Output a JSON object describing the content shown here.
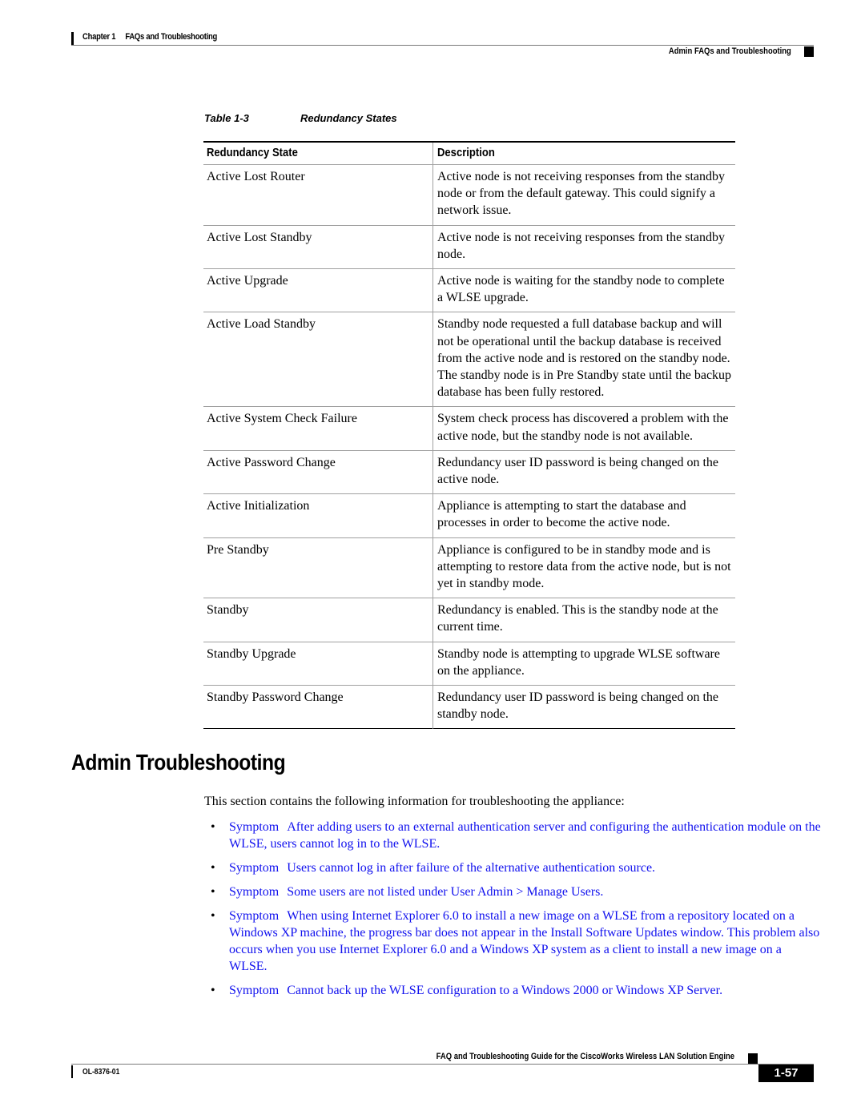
{
  "header": {
    "chapter_label": "Chapter 1",
    "chapter_title": "FAQs and Troubleshooting",
    "section_title": "Admin FAQs and Troubleshooting"
  },
  "table": {
    "caption_number": "Table 1-3",
    "caption_title": "Redundancy States",
    "columns": [
      "Redundancy State",
      "Description"
    ],
    "rows": [
      {
        "state": "Active Lost Router",
        "description": "Active node is not receiving responses from the standby node or from the default gateway. This could signify a network issue."
      },
      {
        "state": "Active Lost Standby",
        "description": "Active node is not receiving responses from the standby node."
      },
      {
        "state": "Active Upgrade",
        "description": "Active node is waiting for the standby node to complete a WLSE upgrade."
      },
      {
        "state": "Active Load Standby",
        "description": "Standby node requested a full database backup and will not be operational until the backup database is received from the active node and is restored on the standby node. The standby node is in Pre Standby state until the backup database has been fully restored."
      },
      {
        "state": "Active System Check Failure",
        "description": "System check process has discovered a problem with the active node, but the standby node is not available."
      },
      {
        "state": "Active Password Change",
        "description": "Redundancy user ID password is being changed on the active node."
      },
      {
        "state": "Active Initialization",
        "description": "Appliance is attempting to start the database and processes in order to become the active node."
      },
      {
        "state": "Pre Standby",
        "description": "Appliance is configured to be in standby mode and is attempting to restore data from the active node, but is not yet in standby mode."
      },
      {
        "state": "Standby",
        "description": "Redundancy is enabled. This is the standby node at the current time."
      },
      {
        "state": "Standby Upgrade",
        "description": "Standby node is attempting to upgrade WLSE software on the appliance."
      },
      {
        "state": "Standby Password Change",
        "description": "Redundancy user ID password is being changed on the standby node."
      }
    ]
  },
  "section": {
    "heading": "Admin Troubleshooting",
    "intro": "This section contains the following information for troubleshooting the appliance:",
    "bullet_glyph": "•",
    "symptoms": [
      {
        "label": "Symptom",
        "text": "After adding users to an external authentication server and configuring the authentication module on the WLSE, users cannot log in to the WLSE."
      },
      {
        "label": "Symptom",
        "text": "Users cannot log in after failure of the alternative authentication source."
      },
      {
        "label": "Symptom",
        "text": "Some users are not listed under User Admin > Manage Users."
      },
      {
        "label": "Symptom",
        "text": "When using Internet Explorer 6.0 to install a new image on a WLSE from a repository located on a Windows XP machine, the progress bar does not appear in the Install Software Updates window. This problem also occurs when you use Internet Explorer 6.0 and a Windows XP system as a client to install a new image on a WLSE."
      },
      {
        "label": "Symptom",
        "text": "Cannot back up the WLSE configuration to a Windows 2000 or Windows XP Server."
      }
    ]
  },
  "footer": {
    "guide_title": "FAQ and Troubleshooting Guide for the CiscoWorks Wireless LAN Solution Engine",
    "doc_number": "OL-8376-01",
    "page_number": "1-57"
  },
  "colors": {
    "link": "#1111ee",
    "text": "#000000",
    "rule": "#a0a0a0"
  }
}
